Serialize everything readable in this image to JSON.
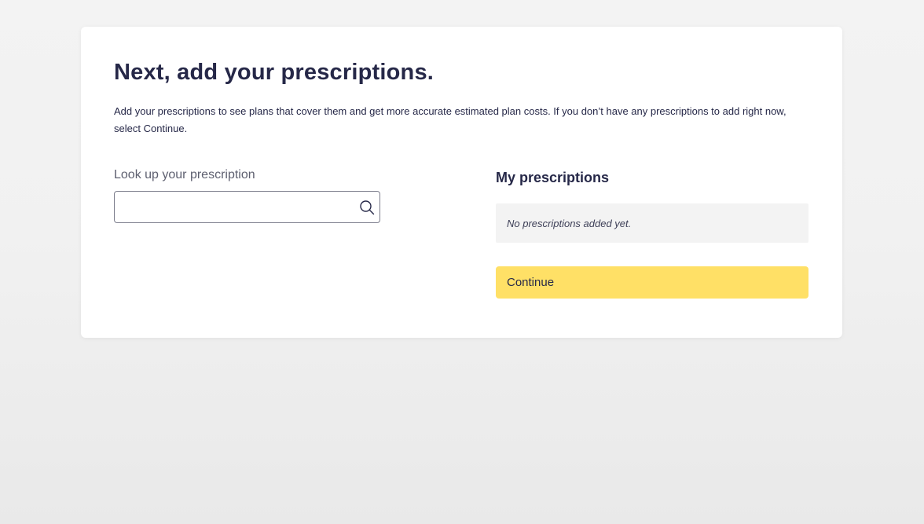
{
  "colors": {
    "page_background": "#ececec",
    "card_background": "#ffffff",
    "heading_text": "#262848",
    "continue_button": "#ffe066",
    "empty_state_background": "#f3f3f3"
  },
  "page": {
    "title": "Next, add your prescriptions.",
    "intro": "Add your prescriptions to see plans that cover them and get more accurate estimated plan costs. If you don’t have any prescriptions to add right now, select Continue."
  },
  "lookup": {
    "label": "Look up your prescription",
    "value": "",
    "placeholder": "",
    "icon": "search-icon"
  },
  "my_prescriptions": {
    "heading": "My prescriptions",
    "empty_message": "No prescriptions added yet."
  },
  "actions": {
    "continue_label": "Continue"
  }
}
